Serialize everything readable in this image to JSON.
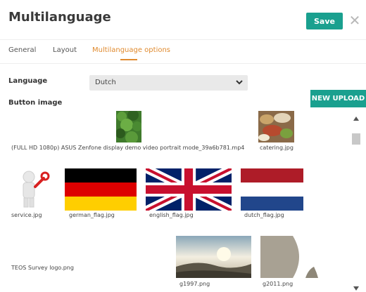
{
  "header": {
    "title": "Multilanguage",
    "save_label": "Save",
    "close_glyph": "✕"
  },
  "tabs": [
    {
      "label": "General",
      "active": false
    },
    {
      "label": "Layout",
      "active": false
    },
    {
      "label": "Multilanguage options",
      "active": true
    }
  ],
  "form": {
    "language_label": "Language",
    "language_value": "Dutch",
    "button_image_label": "Button image",
    "upload_label": "NEW UPLOAD"
  },
  "gallery": {
    "items": [
      {
        "name": "(FULL HD 1080p) ASUS Zenfone display demo video portrait mode_39a6b781.mp4",
        "thumb": "greenery"
      },
      {
        "name": "catering.jpg",
        "thumb": "food"
      },
      {
        "name": "service.jpg",
        "thumb": "service-figure"
      },
      {
        "name": "german_flag.jpg",
        "thumb": "german-flag"
      },
      {
        "name": "english_flag.jpg",
        "thumb": "union-jack"
      },
      {
        "name": "dutch_flag.jpg",
        "thumb": "dutch-flag"
      },
      {
        "name": "TEOS Survey logo.png",
        "thumb": "blank"
      },
      {
        "name": "g1997.png",
        "thumb": "landscape"
      },
      {
        "name": "g2011.png",
        "thumb": "abstract-shape"
      }
    ]
  },
  "colors": {
    "accent": "#1aa08f",
    "tab_active": "#e08a2e",
    "german": [
      "#000000",
      "#dd0000",
      "#ffce00"
    ],
    "dutch": [
      "#ae1c28",
      "#ffffff",
      "#21468b"
    ],
    "uk": [
      "#012169",
      "#ffffff",
      "#c8102e"
    ]
  },
  "icons": {
    "close": "close-icon",
    "select": "chevron-down-icon",
    "scroll_up": "arrow-up-icon",
    "scroll_down": "arrow-down-icon"
  }
}
